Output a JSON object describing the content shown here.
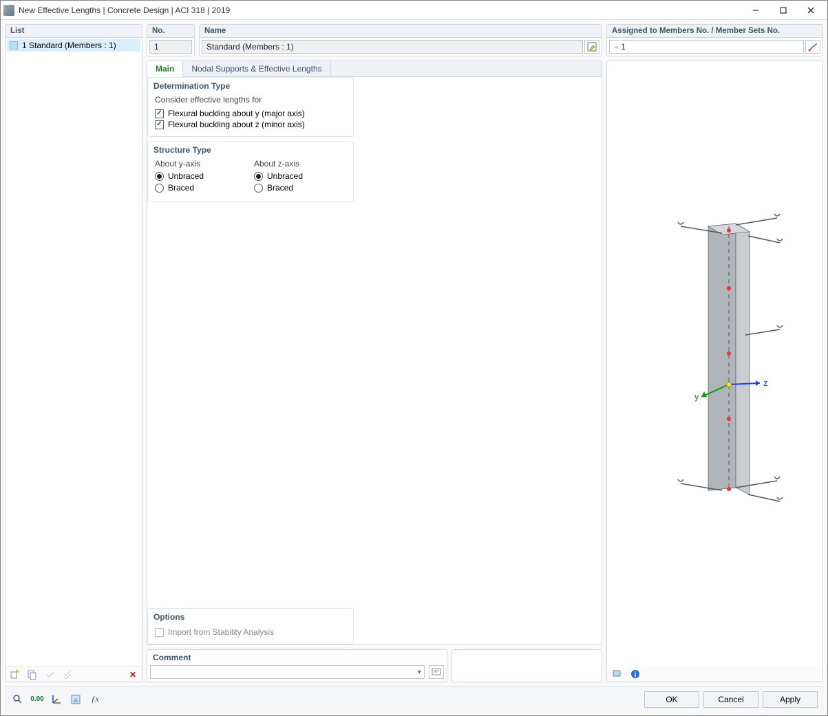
{
  "window": {
    "title": "New Effective Lengths | Concrete Design | ACI 318 | 2019"
  },
  "listPanel": {
    "header": "List",
    "items": [
      {
        "text": "1 Standard (Members : 1)"
      }
    ]
  },
  "noPanel": {
    "header": "No.",
    "value": "1"
  },
  "namePanel": {
    "header": "Name",
    "value": "Standard (Members : 1)"
  },
  "assignedPanel": {
    "header": "Assigned to Members No. / Member Sets No.",
    "value": "1"
  },
  "tabs": {
    "main": "Main",
    "nodal": "Nodal Supports & Effective Lengths"
  },
  "determination": {
    "title": "Determination Type",
    "consider": "Consider effective lengths for",
    "opt1": "Flexural buckling about y (major axis)",
    "opt2": "Flexural buckling about z (minor axis)"
  },
  "structure": {
    "title": "Structure Type",
    "aboutY": "About y-axis",
    "aboutZ": "About z-axis",
    "unbraced": "Unbraced",
    "braced": "Braced"
  },
  "optionsPanel": {
    "title": "Options",
    "import": "Import from Stability Analysis"
  },
  "commentPanel": {
    "title": "Comment",
    "value": ""
  },
  "buttons": {
    "ok": "OK",
    "cancel": "Cancel",
    "apply": "Apply"
  },
  "preview": {
    "y": "y",
    "z": "z"
  },
  "icons": {
    "assignedPrefix": "⤷"
  }
}
